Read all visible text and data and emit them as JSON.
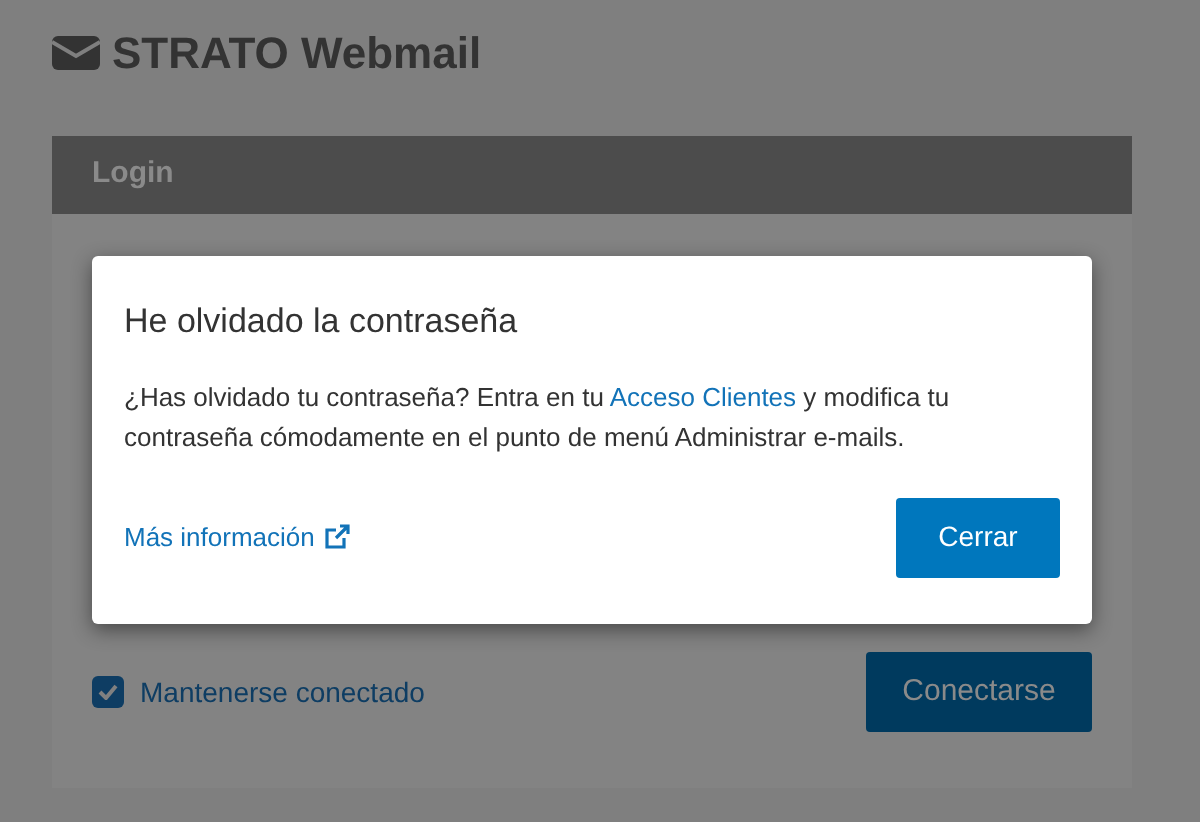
{
  "header": {
    "title": "STRATO Webmail"
  },
  "login_panel": {
    "title": "Login",
    "remember_me": {
      "label": "Mantenerse conectado",
      "checked": true
    },
    "submit_button": "Conectarse"
  },
  "dialog": {
    "title": "He olvidado la contraseña",
    "message": {
      "text_before": "¿Has olvidado tu contraseña? Entra en tu ",
      "link": "Acceso Clientes",
      "text_after": " y modifica tu contraseña cómodamente en el punto de menú Administrar e-mails."
    },
    "more_info_link": "Más información",
    "close_button": "Cerrar"
  }
}
